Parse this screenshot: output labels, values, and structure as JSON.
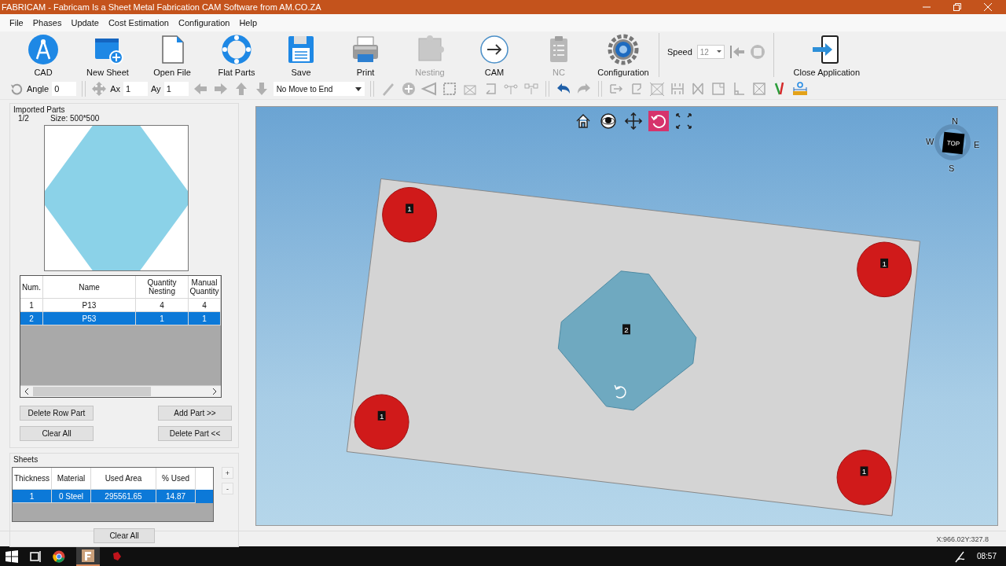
{
  "window": {
    "title": "FABRICAM - Fabricam Is a Sheet Metal Fabrication CAM Software from AM.CO.ZA"
  },
  "menu": [
    "File",
    "Phases",
    "Update",
    "Cost Estimation",
    "Configuration",
    "Help"
  ],
  "toolbar": {
    "buttons": [
      {
        "label": "CAD",
        "disabled": false
      },
      {
        "label": "New Sheet",
        "disabled": false
      },
      {
        "label": "Open File",
        "disabled": false
      },
      {
        "label": "Flat Parts",
        "disabled": false
      },
      {
        "label": "Save",
        "disabled": false
      },
      {
        "label": "Print",
        "disabled": false
      },
      {
        "label": "Nesting",
        "disabled": true
      },
      {
        "label": "CAM",
        "disabled": false
      },
      {
        "label": "NC",
        "disabled": true
      },
      {
        "label": "Configuration",
        "disabled": false
      }
    ],
    "speed": {
      "label": "Speed",
      "value": "12"
    },
    "close": {
      "label": "Close Application"
    }
  },
  "edit_bar": {
    "angle": {
      "label": "Angle",
      "value": "0"
    },
    "ax": {
      "label": "Ax",
      "value": "1"
    },
    "ay": {
      "label": "Ay",
      "value": "1"
    },
    "move_mode": {
      "value": "No Move to End"
    }
  },
  "imported_parts": {
    "title": "Imported Parts",
    "page": "1/2",
    "size": "Size: 500*500",
    "columns": [
      "Num.",
      "Name",
      "Quantity Nesting",
      "Manual Quantity"
    ],
    "rows": [
      {
        "cells": [
          "1",
          "P13",
          "4",
          "4"
        ],
        "selected": false
      },
      {
        "cells": [
          "2",
          "P53",
          "1",
          "1"
        ],
        "selected": true
      }
    ],
    "buttons": [
      "Delete Row Part",
      "Add Part >>",
      "Clear All",
      "Delete Part <<"
    ]
  },
  "sheets": {
    "title": "Sheets",
    "columns": [
      "Thickness",
      "Material",
      "Used Area",
      "% Used"
    ],
    "rows": [
      {
        "cells": [
          "1",
          "0  Steel",
          "295561.65",
          "14.87"
        ],
        "selected": true
      }
    ],
    "side_buttons": [
      "+",
      "-"
    ],
    "clear_button": "Clear All"
  },
  "viewport": {
    "view_tools": [
      {
        "selected": false
      },
      {
        "selected": false
      },
      {
        "selected": false
      },
      {
        "selected": true
      },
      {
        "selected": false
      }
    ],
    "compass": {
      "north": "N",
      "west": "W",
      "east": "E",
      "south": "S",
      "face": "TOP"
    },
    "parts": [
      {
        "kind": "circle",
        "label": "1"
      },
      {
        "kind": "circle",
        "label": "1"
      },
      {
        "kind": "polygon",
        "label": "2"
      },
      {
        "kind": "circle",
        "label": "1"
      },
      {
        "kind": "circle",
        "label": "1"
      }
    ]
  },
  "status_bar": {
    "coordinates": "X:966.02Y:327.8"
  },
  "taskbar": {
    "clock": "08:57"
  }
}
